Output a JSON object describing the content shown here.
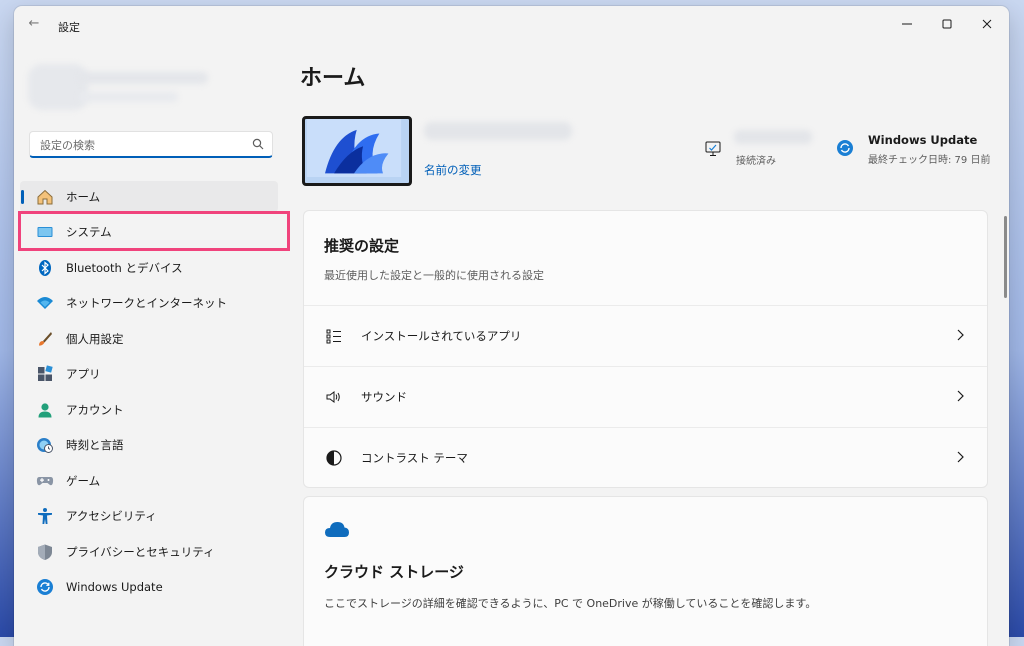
{
  "window": {
    "title": "設定",
    "controls": {
      "minimize": "minimize-icon",
      "maximize": "maximize-icon",
      "close": "close-icon"
    }
  },
  "search": {
    "placeholder": "設定の検索",
    "value": ""
  },
  "sidebar": {
    "items": [
      {
        "label": "ホーム",
        "icon": "home-icon",
        "selected": true
      },
      {
        "label": "システム",
        "icon": "display-icon",
        "selected": false
      },
      {
        "label": "Bluetooth とデバイス",
        "icon": "bluetooth-icon",
        "selected": false
      },
      {
        "label": "ネットワークとインターネット",
        "icon": "wifi-icon",
        "selected": false
      },
      {
        "label": "個人用設定",
        "icon": "brush-icon",
        "selected": false
      },
      {
        "label": "アプリ",
        "icon": "apps-icon",
        "selected": false
      },
      {
        "label": "アカウント",
        "icon": "person-icon",
        "selected": false
      },
      {
        "label": "時刻と言語",
        "icon": "globe-clock-icon",
        "selected": false
      },
      {
        "label": "ゲーム",
        "icon": "gamepad-icon",
        "selected": false
      },
      {
        "label": "アクセシビリティ",
        "icon": "accessibility-icon",
        "selected": false
      },
      {
        "label": "プライバシーとセキュリティ",
        "icon": "shield-icon",
        "selected": false
      },
      {
        "label": "Windows Update",
        "icon": "update-icon",
        "selected": false
      }
    ]
  },
  "main": {
    "title": "ホーム",
    "device": {
      "rename_link": "名前の変更"
    },
    "status": {
      "text": "接続済み"
    },
    "windows_update": {
      "title": "Windows Update",
      "subtitle": "最終チェック日時: 79 日前"
    },
    "recommended": {
      "title": "推奨の設定",
      "subtitle": "最近使用した設定と一般的に使用される設定",
      "rows": [
        {
          "label": "インストールされているアプリ",
          "icon": "list-icon"
        },
        {
          "label": "サウンド",
          "icon": "speaker-icon"
        },
        {
          "label": "コントラスト テーマ",
          "icon": "contrast-icon"
        }
      ]
    },
    "cloud": {
      "title": "クラウド ストレージ",
      "subtitle": "ここでストレージの詳細を確認できるように、PC で OneDrive が稼働していることを確認します。"
    }
  },
  "colors": {
    "accent": "#005fb8",
    "highlight_border": "#f0437c",
    "window_bg": "#f3f3f3"
  }
}
